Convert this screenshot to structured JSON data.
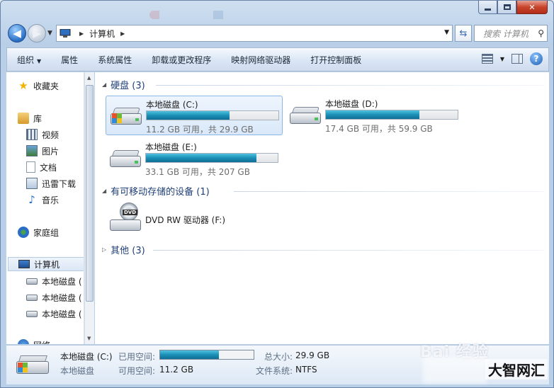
{
  "window": {
    "caption_min": "",
    "caption_max": "",
    "caption_close": "✕"
  },
  "address": {
    "crumbs": [
      "计算机"
    ],
    "search_placeholder": "搜索 计算机"
  },
  "toolbar": {
    "organize": "组织",
    "properties": "属性",
    "system_properties": "系统属性",
    "uninstall": "卸载或更改程序",
    "map_drive": "映射网络驱动器",
    "control_panel": "打开控制面板"
  },
  "sidebar": {
    "items": [
      {
        "label": "收藏夹",
        "icon": "star-icon"
      },
      {
        "label": "库",
        "icon": "library-icon"
      },
      {
        "label": "视频",
        "icon": "video-icon"
      },
      {
        "label": "图片",
        "icon": "picture-icon"
      },
      {
        "label": "文档",
        "icon": "document-icon"
      },
      {
        "label": "迅雷下载",
        "icon": "download-folder-icon"
      },
      {
        "label": "音乐",
        "icon": "music-icon"
      },
      {
        "label": "家庭组",
        "icon": "homegroup-icon"
      },
      {
        "label": "计算机",
        "icon": "computer-icon"
      },
      {
        "label": "本地磁盘 (",
        "icon": "local-disk-icon"
      },
      {
        "label": "本地磁盘 (",
        "icon": "local-disk-icon"
      },
      {
        "label": "本地磁盘 (",
        "icon": "local-disk-icon"
      },
      {
        "label": "网络",
        "icon": "network-icon"
      }
    ]
  },
  "groups": {
    "hard_disks": "硬盘 (3)",
    "removable": "有可移动存储的设备 (1)",
    "other": "其他 (3)"
  },
  "drives": [
    {
      "name": "本地磁盘 (C:)",
      "info": "11.2 GB 可用，共 29.9 GB",
      "used_fraction": 0.63,
      "selected": true
    },
    {
      "name": "本地磁盘 (D:)",
      "info": "17.4 GB 可用，共 59.9 GB",
      "used_fraction": 0.71,
      "selected": false
    },
    {
      "name": "本地磁盘 (E:)",
      "info": "33.1 GB 可用，共 207 GB",
      "used_fraction": 0.84,
      "selected": false
    }
  ],
  "dvd": {
    "name": "DVD RW 驱动器 (F:)",
    "badge": "DVD"
  },
  "details": {
    "name": "本地磁盘 (C:)",
    "type": "本地磁盘",
    "used_label": "已用空间:",
    "free_label": "可用空间:",
    "free_value": "11.2 GB",
    "total_label": "总大小:",
    "total_value": "29.9 GB",
    "fs_label": "文件系统:",
    "fs_value": "NTFS",
    "used_fraction": 0.63
  },
  "watermark": {
    "baidu": "Bai 经验",
    "site": "大智网汇"
  },
  "colors": {
    "accent": "#1c8fb7",
    "selection": "#d9e8f9"
  }
}
